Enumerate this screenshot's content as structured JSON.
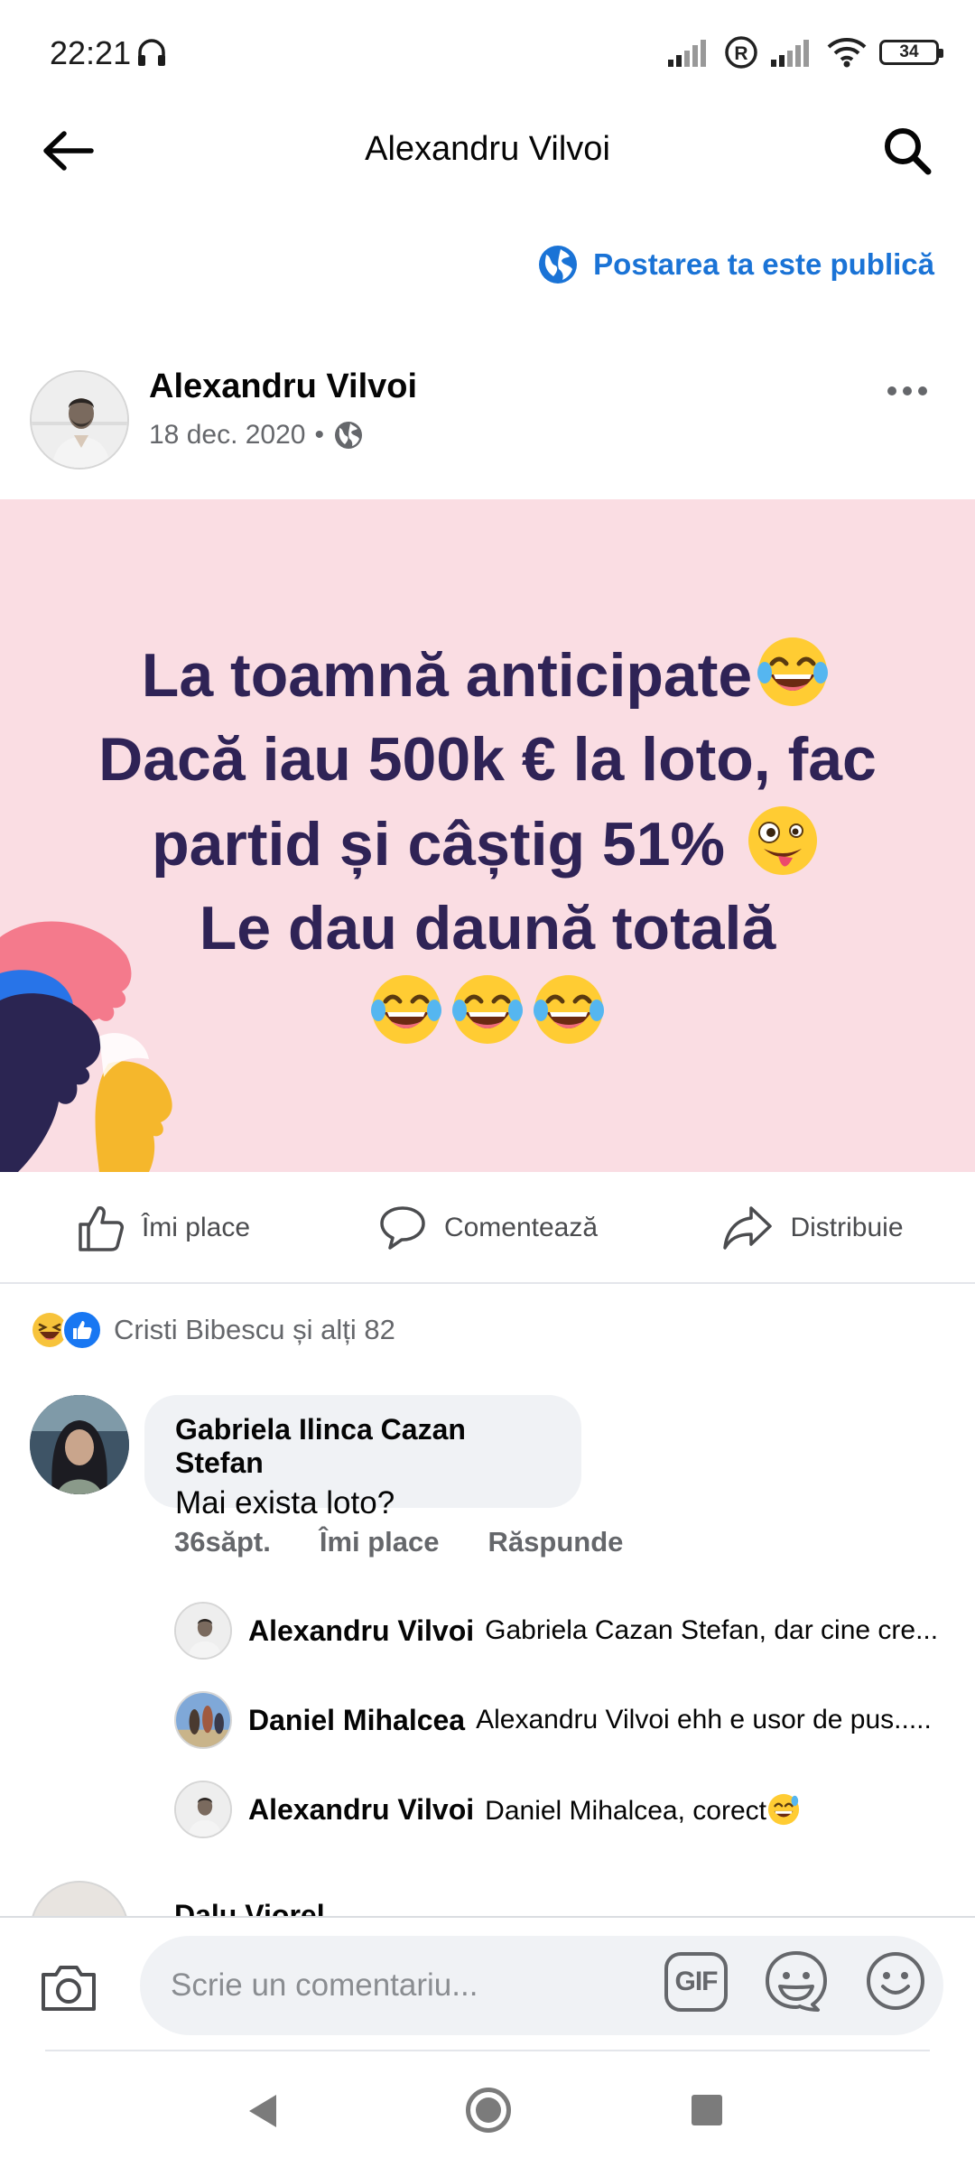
{
  "status_bar": {
    "time": "22:21",
    "battery": "34",
    "icons": [
      "headphones-icon",
      "signal-icon",
      "roaming-icon",
      "signal-icon",
      "wifi-icon",
      "battery-icon"
    ]
  },
  "header": {
    "title": "Alexandru Vilvoi",
    "back_icon": "arrow-left-icon",
    "search_icon": "search-icon"
  },
  "privacy": {
    "text": "Postarea ta este publică",
    "icon": "globe-icon",
    "color": "#1a73d6"
  },
  "post": {
    "author": "Alexandru Vilvoi",
    "date": "18 dec. 2020",
    "separator": "•",
    "audience_icon": "globe-icon",
    "banner": {
      "background": "#fadde3",
      "text_color": "#2f2356",
      "line1": "La toamnă anticipate",
      "line2": "Dacă iau 500k € la loto, fac",
      "line3": "partid și câștig 51%",
      "line4": "Le dau daună totală",
      "emojis": [
        "tears-of-joy-emoji",
        "zany-face-emoji",
        "tears-of-joy-emoji",
        "tears-of-joy-emoji",
        "tears-of-joy-emoji"
      ]
    }
  },
  "actions": {
    "like": "Îmi place",
    "comment": "Comentează",
    "share": "Distribuie"
  },
  "reactions": {
    "text": "Cristi Bibescu și alți 82",
    "icons": [
      "haha-reaction-icon",
      "like-reaction-icon"
    ]
  },
  "comments": [
    {
      "author": "Gabriela Ilinca Cazan Stefan",
      "text": "Mai exista loto?",
      "time": "36săpt.",
      "like": "Îmi place",
      "reply": "Răspunde",
      "replies": [
        {
          "author": "Alexandru Vilvoi",
          "text": "Gabriela Cazan Stefan, dar cine cre..."
        },
        {
          "author": "Daniel Mihalcea",
          "text": "Alexandru Vilvoi ehh e usor de pus....."
        },
        {
          "author": "Alexandru Vilvoi",
          "text": "Daniel Mihalcea, corect"
        }
      ]
    },
    {
      "author": "Dalu Viorel"
    }
  ],
  "composer": {
    "placeholder": "Scrie un comentariu...",
    "gif": "GIF",
    "icons": [
      "camera-icon",
      "gif-icon",
      "sticker-icon",
      "emoji-icon"
    ]
  },
  "nav": {
    "icons": [
      "nav-back-icon",
      "nav-home-icon",
      "nav-recents-icon"
    ]
  }
}
